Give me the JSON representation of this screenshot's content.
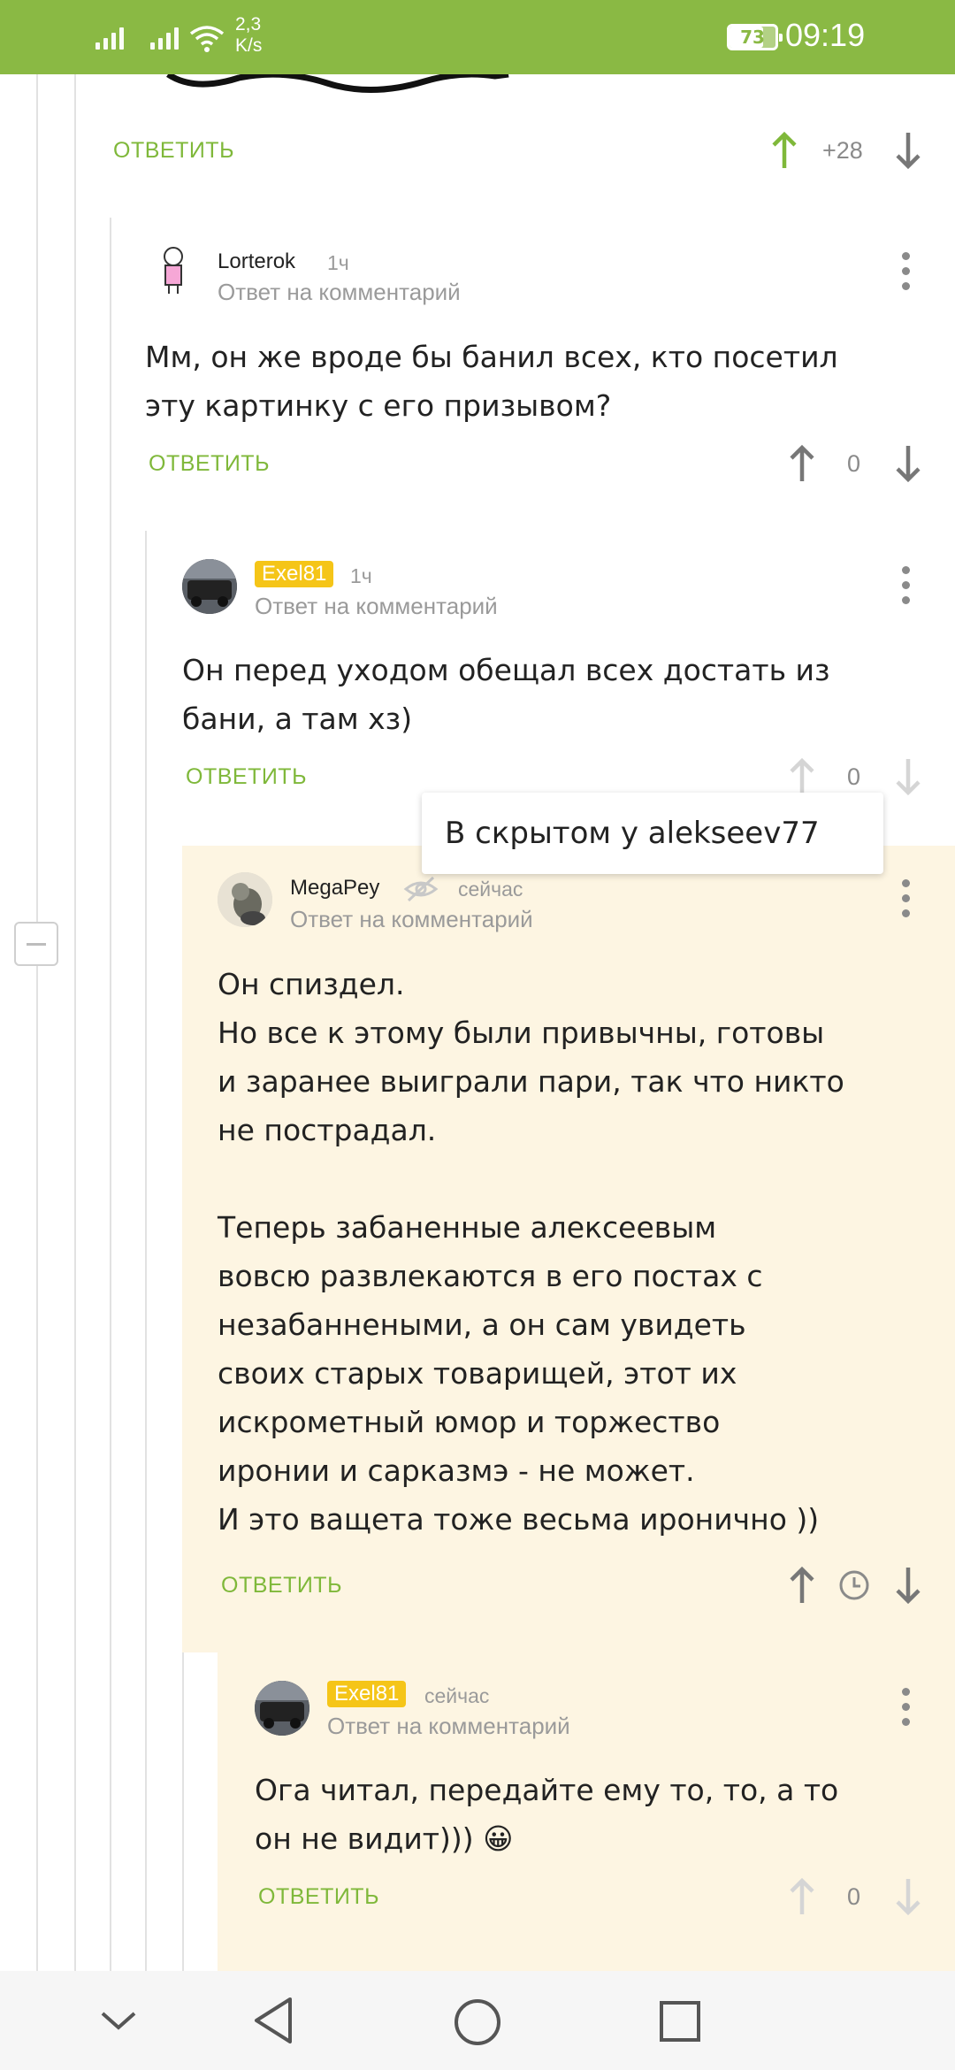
{
  "status_bar": {
    "speed_value": "2,3",
    "speed_unit": "K/s",
    "battery": "73",
    "time": "09:19"
  },
  "top_comment": {
    "reply_label": "ОТВЕТИТЬ",
    "score": "+28"
  },
  "comments": [
    {
      "author": "Lorterok",
      "time": "1ч",
      "reply_to": "Ответ на комментарий",
      "body_lines": [
        "Мм, он же вроде бы банил всех, кто посетил",
        "эту картинку с его призывом?"
      ],
      "reply_label": "ОТВЕТИТЬ",
      "score": "0"
    },
    {
      "author": "Exel81",
      "time": "1ч",
      "reply_to": "Ответ на комментарий",
      "body_lines": [
        "Он перед уходом обещал всех достать из",
        "бани, а там хз)"
      ],
      "reply_label": "ОТВЕТИТЬ",
      "score": "0"
    },
    {
      "author": "MegaPey",
      "time": "сейчас",
      "reply_to": "Ответ на комментарий",
      "body_lines": [
        "Он спиздел.",
        "Но все к этому были привычны, готовы",
        "и заранее выиграли пари, так что никто",
        "не пострадал.",
        "",
        "Теперь забаненные алексеевым",
        "вовсю развлекаются в его постах с",
        "незабаннеными, а он сам увидеть",
        "своих старых товарищей, этот их",
        "искрометный юмор и торжество",
        "иронии и сарказмэ - не может.",
        "И это ващета тоже весьма иронично ))"
      ],
      "reply_label": "ОТВЕТИТЬ"
    },
    {
      "author": "Exel81",
      "time": "сейчас",
      "reply_to": "Ответ на комментарий",
      "body_lines": [
        "Ога читал, передайте ему то, то, а то",
        "он не видит))) 😀"
      ],
      "reply_label": "ОТВЕТИТЬ",
      "score": "0"
    }
  ],
  "tooltip": "В скрытом у alekseev77",
  "colors": {
    "brand_green": "#8ab944",
    "reply_green": "#7fb83a",
    "hidden_bg": "#fdf5e2",
    "tag_yellow": "#f5c518"
  },
  "icons": {
    "hidden": "eye-off-icon",
    "timer": "clock-icon",
    "vote_up": "arrow-up-icon",
    "vote_down": "arrow-down-icon",
    "more": "kebab-menu-icon"
  }
}
